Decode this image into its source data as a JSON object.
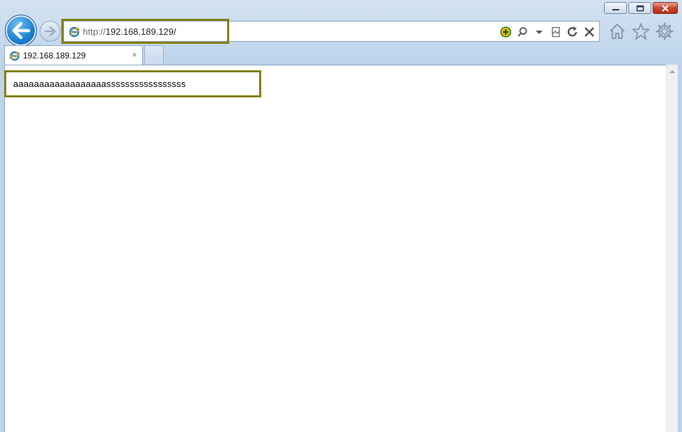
{
  "window": {
    "caption": {
      "minimize": "minimize",
      "restore": "restore",
      "close": "close"
    }
  },
  "address_bar": {
    "url_protocol": "http://",
    "url_host": "192.168.189.129/"
  },
  "tabs": [
    {
      "label": "192.168.189.129",
      "close_glyph": "×"
    }
  ],
  "page": {
    "text": "aaaaaaaaaaaaaaaaaasssssssssssssssss"
  },
  "colors": {
    "highlight_border": "#858008",
    "back_button": "#1d82d4",
    "chrome_background": "#bcd3ea"
  },
  "icons": [
    "back-arrow-icon",
    "forward-arrow-icon",
    "ie-logo-icon",
    "add-on-icon",
    "search-icon",
    "dropdown-chevron-icon",
    "compatibility-view-icon",
    "refresh-icon",
    "stop-icon",
    "home-icon",
    "favorites-star-icon",
    "gear-icon"
  ]
}
